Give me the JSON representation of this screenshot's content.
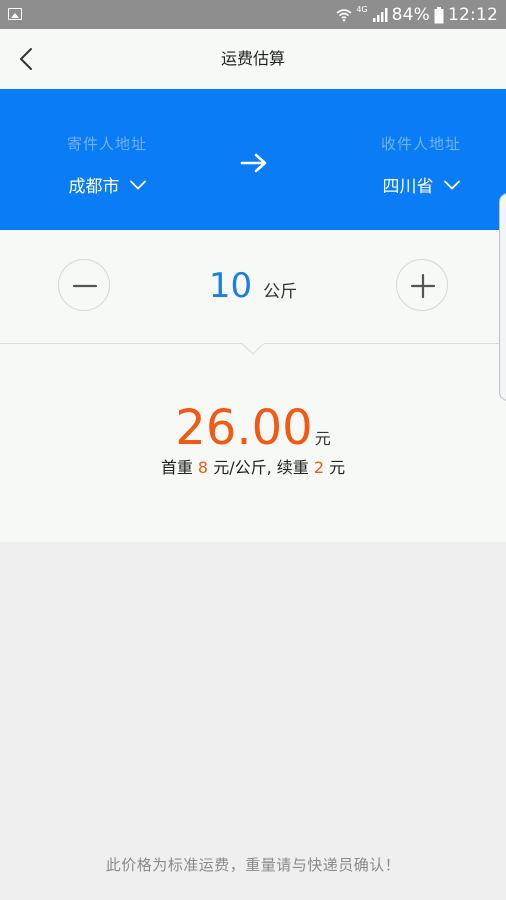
{
  "status_bar": {
    "network": "4G",
    "battery": "84%",
    "time": "12:12",
    "icons": [
      "gallery-icon",
      "wifi-icon",
      "signal-icon",
      "battery-icon"
    ]
  },
  "header": {
    "title": "运费估算",
    "back_icon": "chevron-left-icon"
  },
  "address": {
    "sender_label": "寄件人地址",
    "sender_value": "成都市",
    "receiver_label": "收件人地址",
    "receiver_value": "四川省",
    "arrow_icon": "arrow-right-icon",
    "band_color": "#0a7cf5"
  },
  "weight": {
    "value": "10",
    "unit": "公斤",
    "minus_icon": "minus-icon",
    "plus_icon": "plus-icon"
  },
  "price": {
    "amount": "26.00",
    "unit": "元",
    "first_weight_label": "首重",
    "first_weight_price": "8",
    "per_unit": "元/公斤,",
    "extra_weight_label": "续重",
    "extra_weight_price": "2",
    "extra_unit": "元",
    "accent_color": "#f05a14"
  },
  "footer": {
    "note": "此价格为标准运费，重量请与快递员确认！"
  }
}
